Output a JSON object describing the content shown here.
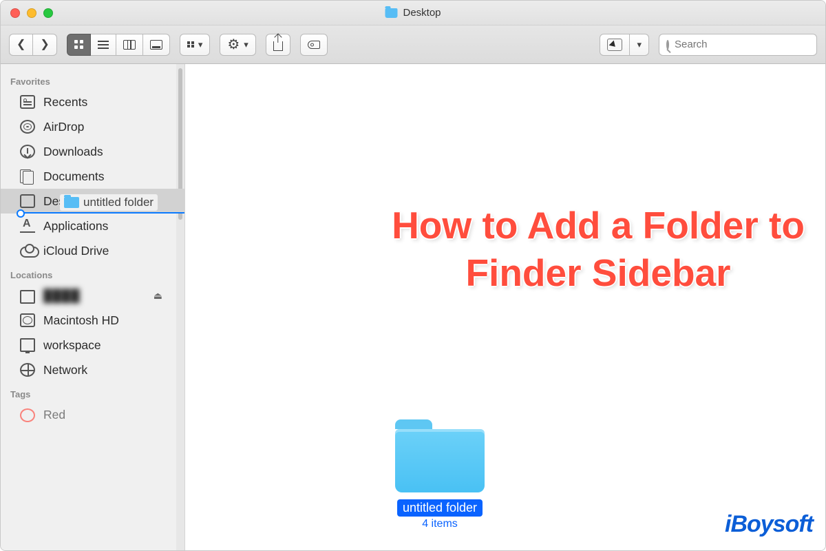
{
  "window": {
    "title": "Desktop"
  },
  "search": {
    "placeholder": "Search"
  },
  "sidebar": {
    "sections": {
      "favorites": "Favorites",
      "locations": "Locations",
      "tags": "Tags"
    },
    "favorites": [
      {
        "label": "Recents"
      },
      {
        "label": "AirDrop"
      },
      {
        "label": "Downloads"
      },
      {
        "label": "Documents"
      },
      {
        "label": "Desktop"
      },
      {
        "label": "Applications"
      },
      {
        "label": "iCloud Drive"
      }
    ],
    "drag_item_label": "untitled folder",
    "locations": [
      {
        "label": ""
      },
      {
        "label": "Macintosh HD"
      },
      {
        "label": "workspace"
      },
      {
        "label": "Network"
      }
    ],
    "tags": [
      {
        "label": "Red"
      }
    ]
  },
  "content": {
    "folder": {
      "name": "untitled folder",
      "subtitle": "4 items"
    }
  },
  "overlay": {
    "heading": "How to Add a Folder to Finder Sidebar",
    "watermark": "iBoysoft"
  }
}
